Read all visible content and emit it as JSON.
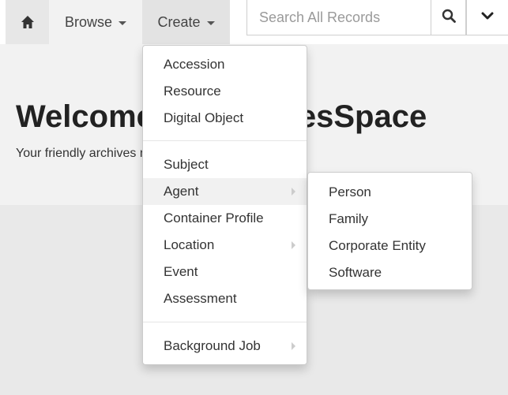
{
  "navbar": {
    "home_icon": "home-icon",
    "browse_label": "Browse",
    "create_label": "Create",
    "search_placeholder": "Search All Records",
    "search_icon": "search-icon",
    "chevron_icon": "chevron-down-icon"
  },
  "banner": {
    "title": "Welcome to ArchivesSpace",
    "subtitle": "Your friendly archives management tool."
  },
  "create_menu": {
    "groups": [
      [
        "Accession",
        "Resource",
        "Digital Object"
      ],
      [
        "Subject",
        "Agent",
        "Container Profile",
        "Location",
        "Event",
        "Assessment"
      ],
      [
        "Background Job"
      ]
    ],
    "active_item": "Agent",
    "submenu_items": [
      "Agent",
      "Location",
      "Background Job"
    ]
  },
  "agent_submenu": {
    "items": [
      "Person",
      "Family",
      "Corporate Entity",
      "Software"
    ]
  },
  "colors": {
    "home_tab": "#e7e7e7",
    "browse_tab": "#f2f2f2",
    "create_tab": "#e3e3e3",
    "banner_bg": "#f2f2f2",
    "lower_bg": "#e9e9e9",
    "menu_active": "#f1f1f1"
  }
}
